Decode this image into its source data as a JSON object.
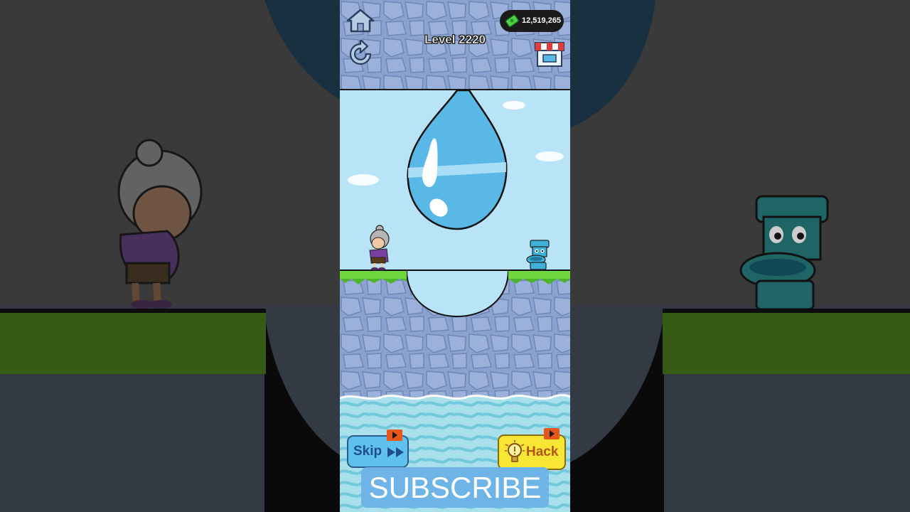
{
  "hud": {
    "cash_amount": "12,519,265",
    "level_label": "Level 2220"
  },
  "buttons": {
    "skip_label": "Skip",
    "hack_label": "Hack",
    "subscribe_label": "SUBSCRIBE"
  },
  "icons": {
    "home": "home-icon",
    "restart": "restart-icon",
    "shop": "shop-icon",
    "cash": "cash-icon",
    "skip": "fast-forward-icon",
    "hack": "lightbulb-icon",
    "video_ad": "play-video-icon"
  },
  "colors": {
    "sky": "#b9e4f8",
    "stone": "#8aa2cf",
    "grass": "#6fd63e",
    "water": "#5ab8e6",
    "sea": "#8fd6e6",
    "skip_button": "#5fc2ee",
    "hack_button": "#f8e634"
  }
}
